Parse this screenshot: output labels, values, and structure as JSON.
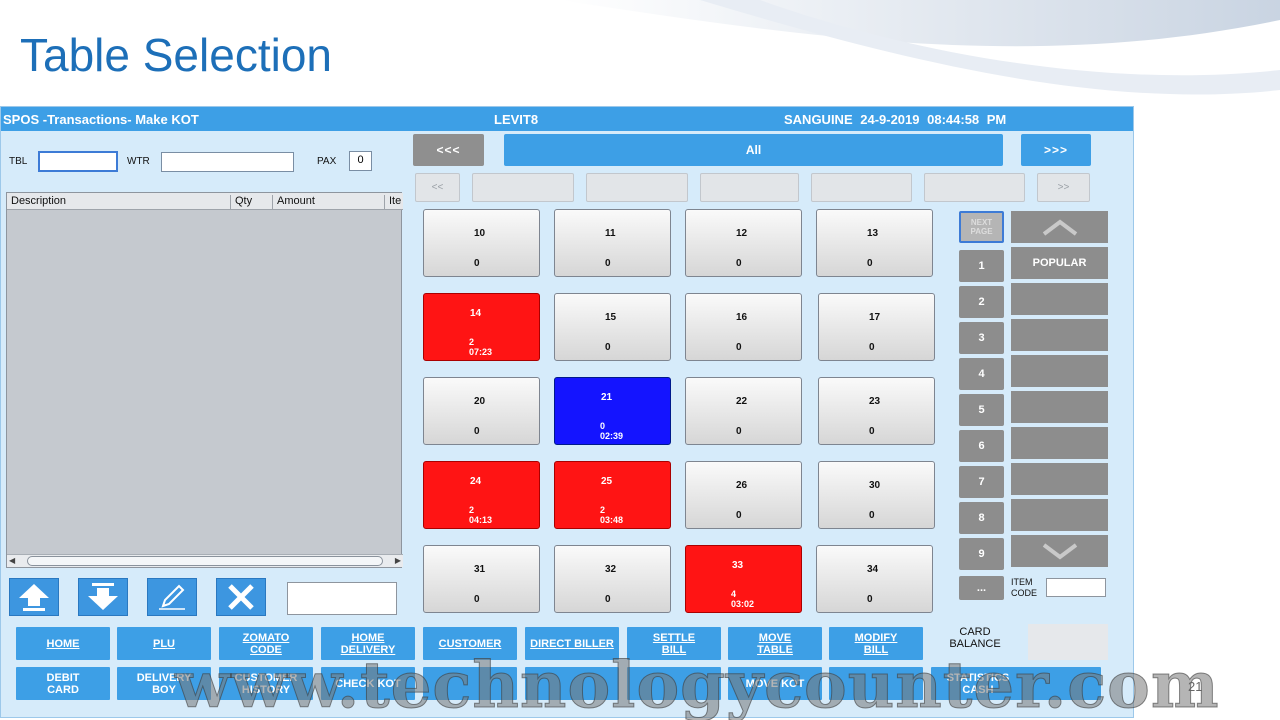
{
  "slide": {
    "title": "Table Selection",
    "number": "21",
    "watermark": "www.technologycounter.com"
  },
  "window": {
    "title_left": "SPOS -Transactions- Make KOT",
    "title_center": "LEVIT8",
    "title_right": "SANGUINE  24-9-2019 08:44:58 PM"
  },
  "form": {
    "tbl_label": "TBL",
    "tbl_value": "",
    "wtr_label": "WTR",
    "wtr_value": "",
    "pax_label": "PAX",
    "pax_value": "0"
  },
  "grid": {
    "columns": [
      "Description",
      "Qty",
      "Amount",
      "Ite"
    ]
  },
  "icons": {
    "up": "arrow-up-icon",
    "down": "arrow-down-icon",
    "edit": "pencil-icon",
    "delete": "close-icon"
  },
  "nav": {
    "prev": "<<<",
    "all": "All",
    "next": ">>>",
    "sub_prev": "<<",
    "sub_next": ">>"
  },
  "tables": [
    {
      "no": "10",
      "pax": "0",
      "time": "",
      "status": "free"
    },
    {
      "no": "11",
      "pax": "0",
      "time": "",
      "status": "free"
    },
    {
      "no": "12",
      "pax": "0",
      "time": "",
      "status": "free"
    },
    {
      "no": "13",
      "pax": "0",
      "time": "",
      "status": "free"
    },
    {
      "no": "14",
      "pax": "2",
      "time": "07:23",
      "status": "occupied"
    },
    {
      "no": "15",
      "pax": "0",
      "time": "",
      "status": "free"
    },
    {
      "no": "16",
      "pax": "0",
      "time": "",
      "status": "free"
    },
    {
      "no": "17",
      "pax": "0",
      "time": "",
      "status": "free"
    },
    {
      "no": "20",
      "pax": "0",
      "time": "",
      "status": "free"
    },
    {
      "no": "21",
      "pax": "0",
      "time": "02:39",
      "status": "running"
    },
    {
      "no": "22",
      "pax": "0",
      "time": "",
      "status": "free"
    },
    {
      "no": "23",
      "pax": "0",
      "time": "",
      "status": "free"
    },
    {
      "no": "24",
      "pax": "2",
      "time": "04:13",
      "status": "occupied"
    },
    {
      "no": "25",
      "pax": "2",
      "time": "03:48",
      "status": "occupied"
    },
    {
      "no": "26",
      "pax": "0",
      "time": "",
      "status": "free"
    },
    {
      "no": "30",
      "pax": "0",
      "time": "",
      "status": "free"
    },
    {
      "no": "31",
      "pax": "0",
      "time": "",
      "status": "free"
    },
    {
      "no": "32",
      "pax": "0",
      "time": "",
      "status": "free"
    },
    {
      "no": "33",
      "pax": "4",
      "time": "03:02",
      "status": "occupied"
    },
    {
      "no": "34",
      "pax": "0",
      "time": "",
      "status": "free"
    }
  ],
  "pages": {
    "next_page": "NEXT PAGE",
    "numbers": [
      "1",
      "2",
      "3",
      "4",
      "5",
      "6",
      "7",
      "8",
      "9",
      "..."
    ]
  },
  "groups": {
    "popular": "POPULAR"
  },
  "item_code": {
    "label_line1": "ITEM",
    "label_line2": "CODE",
    "value": ""
  },
  "functions_row1": [
    {
      "line1": "HOME",
      "line2": ""
    },
    {
      "line1": "PLU",
      "line2": ""
    },
    {
      "line1": "ZOMATO",
      "line2": "CODE"
    },
    {
      "line1": "HOME",
      "line2": "DELIVERY"
    },
    {
      "line1": "CUSTOMER",
      "line2": ""
    },
    {
      "line1": "DIRECT BILLER",
      "line2": ""
    },
    {
      "line1": "SETTLE",
      "line2": "BILL"
    },
    {
      "line1": "MOVE",
      "line2": "TABLE"
    },
    {
      "line1": "MODIFY",
      "line2": "BILL"
    }
  ],
  "card_balance": {
    "line1": "CARD",
    "line2": "BALANCE"
  },
  "functions_row2": [
    {
      "line1": "DEBIT",
      "line2": "CARD"
    },
    {
      "line1": "DELIVERY",
      "line2": "BOY"
    },
    {
      "line1": "CUSTOMER",
      "line2": "HISTORY"
    },
    {
      "line1": "CHECK KOT",
      "line2": ""
    },
    {
      "line1": "",
      "line2": ""
    },
    {
      "line1": "",
      "line2": ""
    },
    {
      "line1": "",
      "line2": ""
    },
    {
      "line1": "MOVE KOT",
      "line2": ""
    },
    {
      "line1": "",
      "line2": ""
    },
    {
      "line1": "STATISTICS",
      "line2": "CASH"
    },
    {
      "line1": "",
      "line2": ""
    }
  ],
  "colors": {
    "accent": "#3d9fe6",
    "occupied": "#ff1414",
    "running": "#1414ff",
    "title_blue": "#1d6fb8"
  }
}
